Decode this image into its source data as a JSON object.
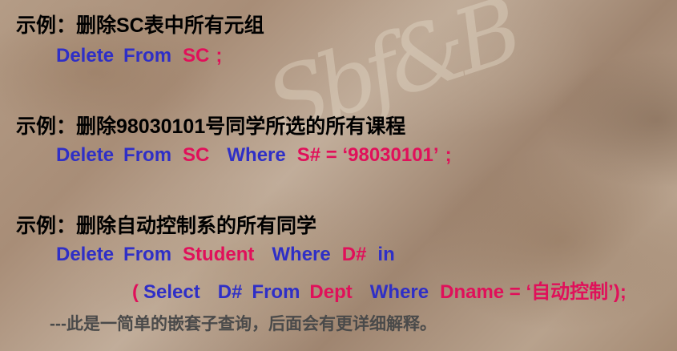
{
  "example1": {
    "heading": "示例：删除SC表中所有元组",
    "delete": "Delete",
    "from": "From",
    "table": "SC",
    "end": ";"
  },
  "example2": {
    "heading": "示例：删除98030101号同学所选的所有课程",
    "delete": "Delete",
    "from": "From",
    "table": "SC",
    "where": "Where",
    "condition": "S# = ‘98030101’",
    "end": ";"
  },
  "example3": {
    "heading": "示例：删除自动控制系的所有同学",
    "delete": "Delete",
    "from": "From",
    "table": "Student",
    "where": "Where",
    "column": "D#",
    "in": "in",
    "open_paren": "(",
    "select": "Select",
    "sub_column": "D#",
    "sub_from": "From",
    "sub_table": "Dept",
    "sub_where": "Where",
    "sub_condition": "Dname = ‘自动控制’);",
    "note": "---此是一简单的嵌套子查询，后面会有更详细解释。"
  }
}
